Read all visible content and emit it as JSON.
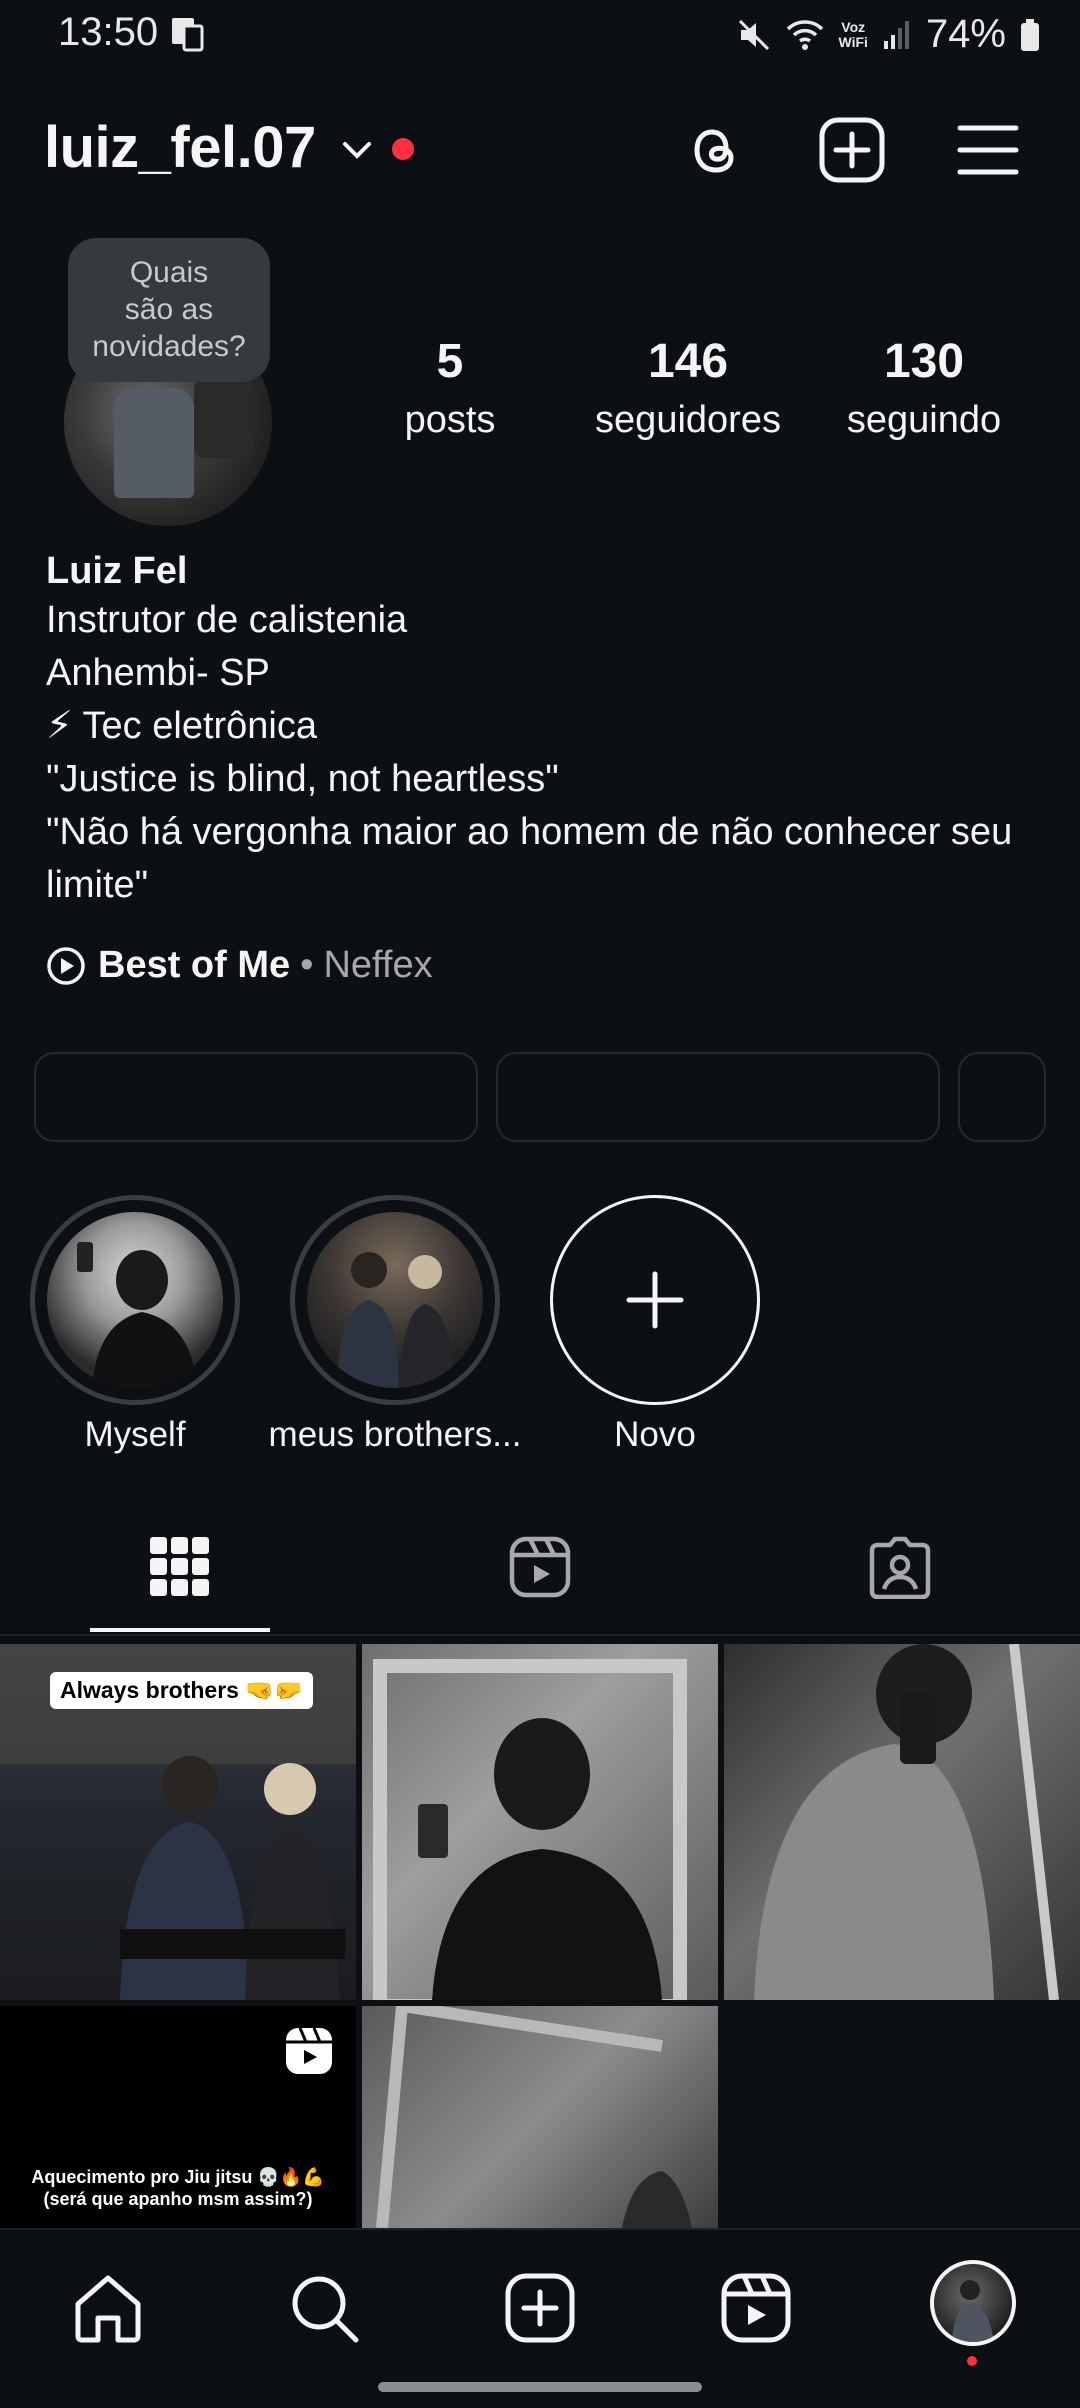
{
  "status_bar": {
    "time": "13:50",
    "battery_text": "74%",
    "voz": "Voz",
    "wifi_label": "WiFi"
  },
  "header": {
    "username": "luiz_fel.07"
  },
  "profile": {
    "note_bubble": [
      "Quais",
      "são as",
      "novidades?"
    ],
    "stats": [
      {
        "value": "5",
        "label": "posts"
      },
      {
        "value": "146",
        "label": "seguidores"
      },
      {
        "value": "130",
        "label": "seguindo"
      }
    ],
    "name": "Luiz Fel",
    "bio_lines": [
      "Instrutor de calistenia",
      "Anhembi- SP",
      "⚡ Tec eletrônica",
      "\"Justice is blind, not heartless\"",
      "\"Não há vergonha maior ao homem de não conhecer seu",
      "limite\""
    ],
    "music": {
      "song": "Best of Me",
      "separator": "•",
      "artist": "Neffex"
    }
  },
  "highlights": [
    {
      "label": "Myself"
    },
    {
      "label": "meus brothers..."
    },
    {
      "label": "Novo"
    }
  ],
  "posts": {
    "post1_overlay": "Always brothers 🤜🤛",
    "post4_caption_1": "Aquecimento pro Jiu jitsu 💀🔥💪",
    "post4_caption_2": "(será que apanho msm assim?)"
  },
  "icons": {
    "header": [
      "threads-icon",
      "create-icon",
      "menu-icon"
    ],
    "tabs": [
      "grid-icon",
      "reels-icon",
      "tagged-icon"
    ],
    "nav": [
      "home-icon",
      "search-icon",
      "create-icon",
      "reels-icon",
      "profile-avatar"
    ]
  },
  "colors": {
    "background": "#0c1014",
    "notification_red": "#ff3040",
    "text": "#f5f5f5",
    "muted": "#a8a8a8"
  }
}
